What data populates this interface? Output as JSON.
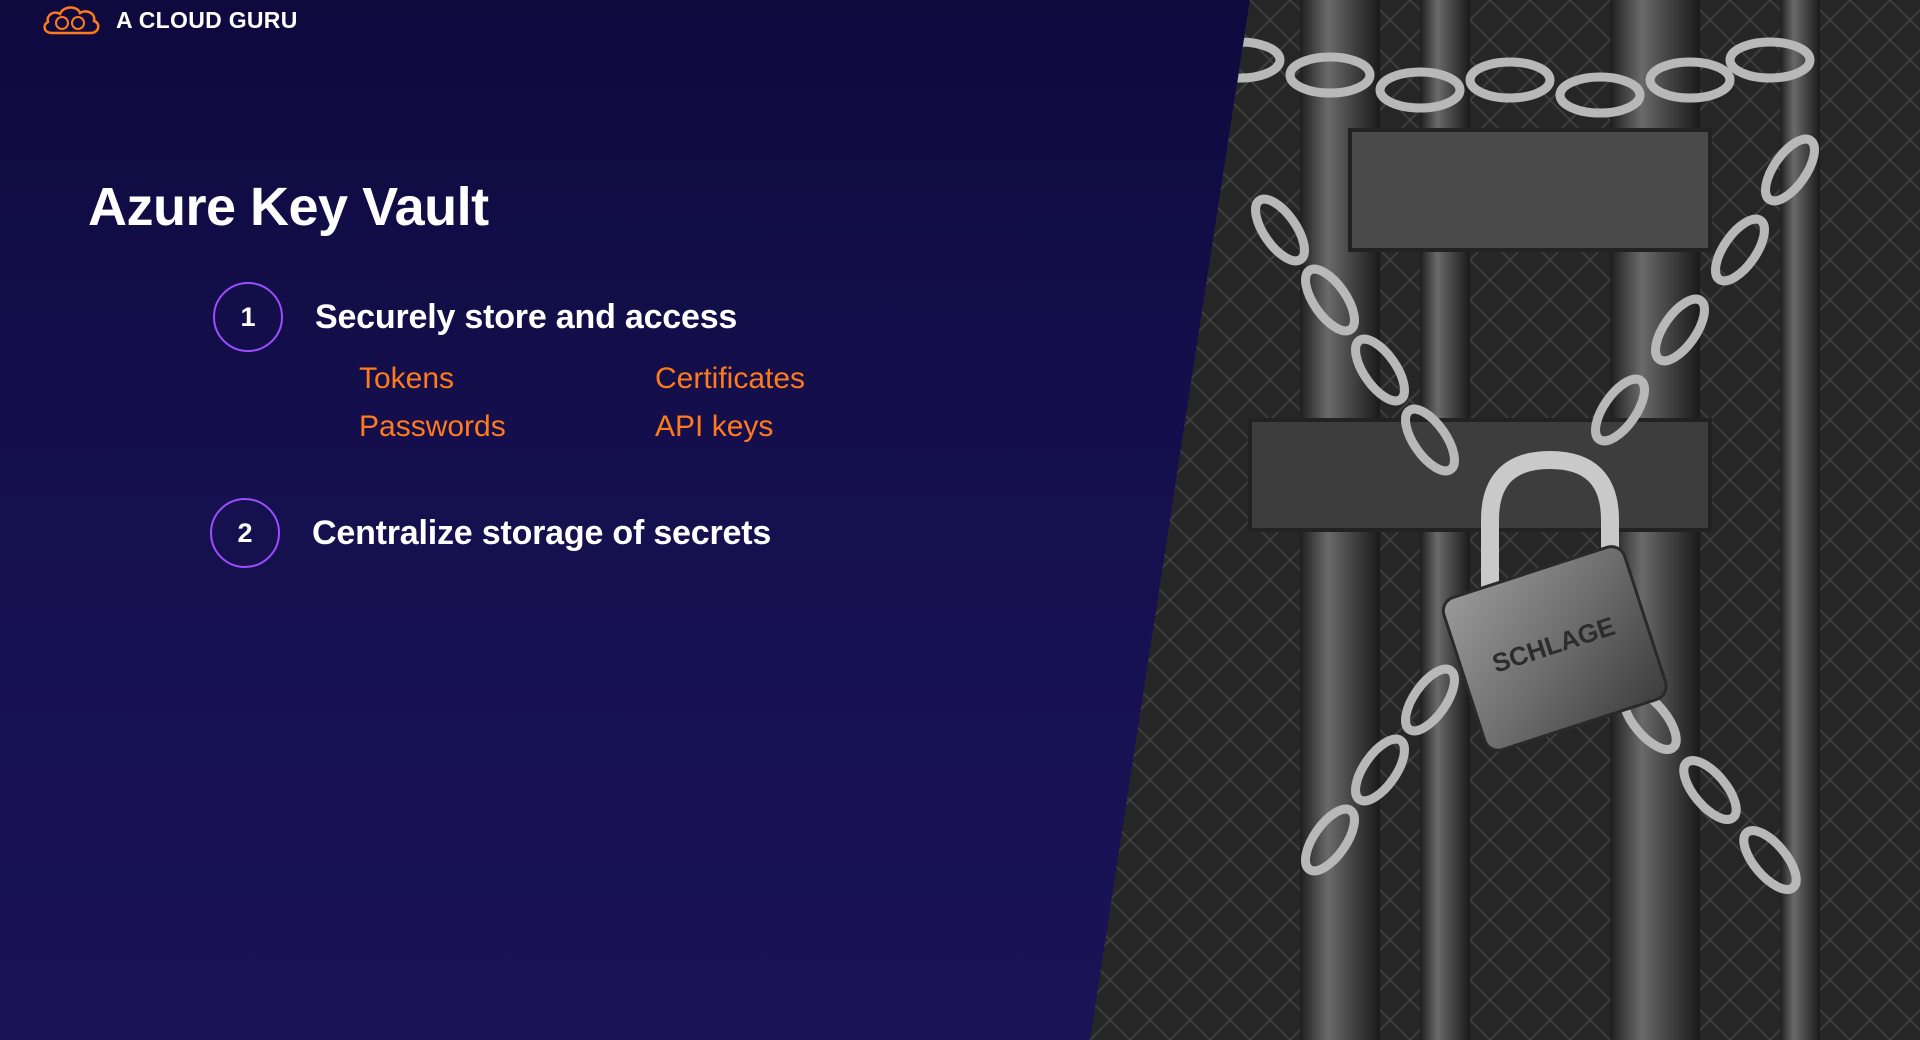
{
  "brand": {
    "name": "A CLOUD GURU",
    "logo_icon": "cloud-logo-icon",
    "accent_color": "#ff7a1a"
  },
  "slide": {
    "title": "Azure Key Vault",
    "points": [
      {
        "number": "1",
        "text": "Securely store and access",
        "items": [
          "Tokens",
          "Certificates",
          "Passwords",
          "API keys"
        ]
      },
      {
        "number": "2",
        "text": "Centralize storage of secrets"
      }
    ]
  },
  "image": {
    "padlock_engraving": "SCHLAGE"
  },
  "colors": {
    "background_top": "#0e0a3e",
    "background_bottom": "#1a1457",
    "circle_border": "#9b4dff",
    "item_text": "#ff7a1a",
    "heading_text": "#ffffff"
  }
}
